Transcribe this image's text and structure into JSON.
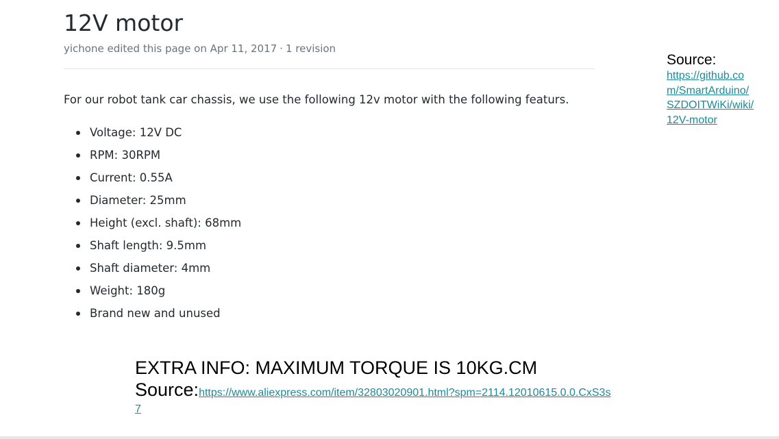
{
  "page": {
    "title": "12V motor",
    "meta": {
      "editor": "yichone",
      "edited_text": "edited this page on",
      "date": "Apr 11, 2017",
      "separator": "·",
      "revisions": "1 revision"
    },
    "intro": "For our robot tank car chassis, we use the following 12v motor with the following featurs.",
    "features": [
      "Voltage: 12V DC",
      "RPM: 30RPM",
      "Current: 0.55A",
      "Diameter: 25mm",
      "Height (excl. shaft): 68mm",
      "Shaft length: 9.5mm",
      "Shaft diameter: 4mm",
      "Weight: 180g",
      "Brand new and unused"
    ]
  },
  "side_source": {
    "label": "Source:",
    "link": "https://github.com/SmartArduino/SZDOITWiKi/wiki/12V-motor"
  },
  "extra_info": {
    "text": "EXTRA INFO: MAXIMUM TORQUE IS 10KG.CM",
    "source_label": "Source:",
    "source_link": "https://www.aliexpress.com/item/32803020901.html?spm=2114.12010615.0.0.CxS3s7"
  },
  "colors": {
    "text": "#24292e",
    "meta": "#6a737d",
    "link": "#1a8a9a",
    "divider": "#e1e4e8"
  }
}
